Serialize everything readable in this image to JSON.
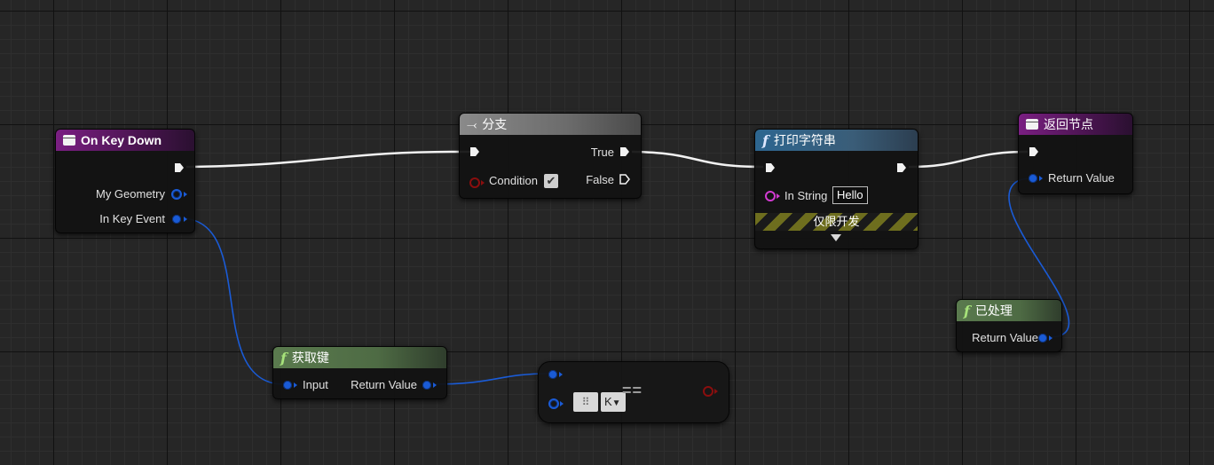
{
  "nodes": {
    "on_key_down": {
      "title": "On Key Down",
      "pins": {
        "my_geometry": "My Geometry",
        "in_key_event": "In Key Event"
      }
    },
    "branch": {
      "title": "分支",
      "pins": {
        "true": "True",
        "false": "False",
        "condition": "Condition"
      },
      "condition_checked": true
    },
    "print_string": {
      "title": "打印字符串",
      "pins": {
        "in_string": "In String"
      },
      "in_string_value": "Hello",
      "dev_only_label": "仅限开发"
    },
    "return_node": {
      "title": "返回节点",
      "pins": {
        "return_value": "Return Value"
      }
    },
    "handled": {
      "title": "已处理",
      "pins": {
        "return_value": "Return Value"
      }
    },
    "get_key": {
      "title": "获取键",
      "pins": {
        "input": "Input",
        "return_value": "Return Value"
      }
    },
    "equal_key": {
      "operator": "==",
      "key_value": "K"
    }
  },
  "colors": {
    "exec_wire": "#f2f2f2",
    "struct_wire": "#1a5bd6",
    "bool_pin": "#8a0e0e",
    "string_pin": "#d23bd2",
    "event_header": "#7a1f82",
    "pure_function_header": "#5a7a4e",
    "function_header": "#2d6690"
  },
  "icons": {
    "event": "event-icon",
    "function": "function-icon",
    "branch": "branch-icon",
    "keyboard": "keyboard-icon"
  }
}
